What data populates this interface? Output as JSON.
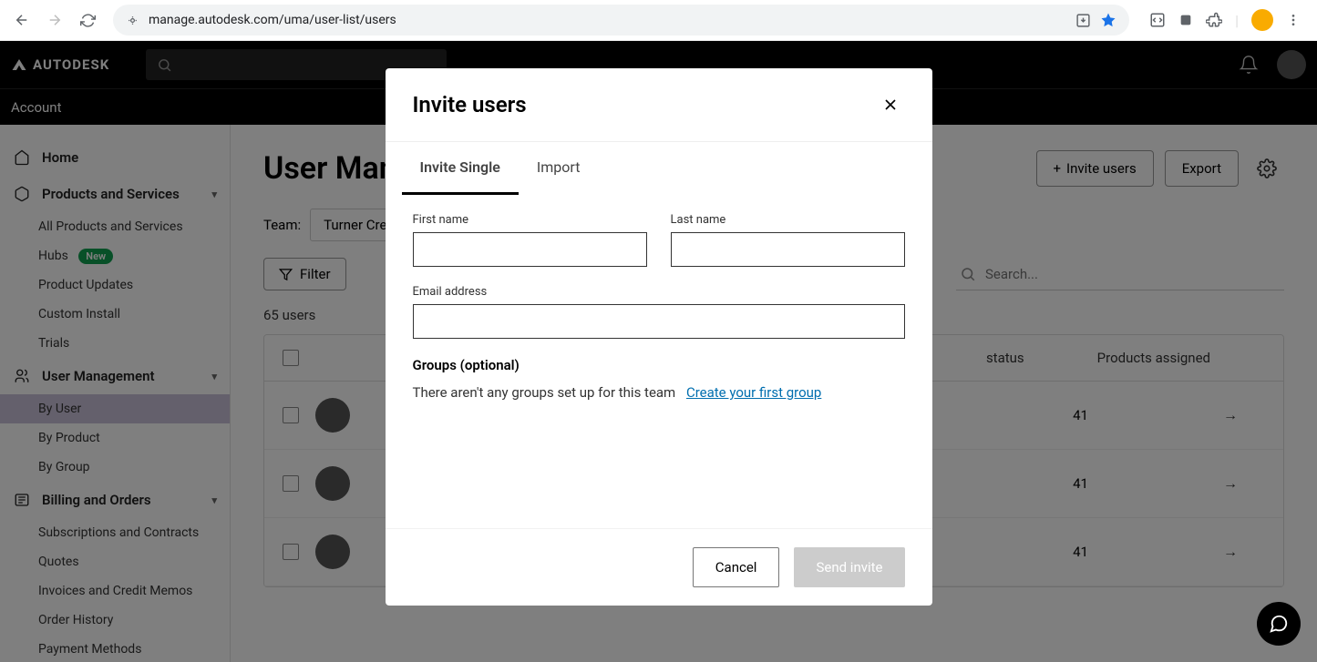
{
  "browser": {
    "url": "manage.autodesk.com/uma/user-list/users"
  },
  "app": {
    "brand": "AUTODESK",
    "subnav": "Account"
  },
  "sidebar": {
    "home": "Home",
    "products_section": "Products and Services",
    "products": {
      "all": "All Products and Services",
      "hubs": "Hubs",
      "hubs_badge": "New",
      "updates": "Product Updates",
      "custom_install": "Custom Install",
      "trials": "Trials"
    },
    "user_section": "User Management",
    "users": {
      "by_user": "By User",
      "by_product": "By Product",
      "by_group": "By Group"
    },
    "billing_section": "Billing and Orders",
    "billing": {
      "subs": "Subscriptions and Contracts",
      "quotes": "Quotes",
      "invoices": "Invoices and Credit Memos",
      "history": "Order History",
      "payment": "Payment Methods"
    }
  },
  "page": {
    "title": "User Management",
    "invite_btn": "Invite users",
    "export_btn": "Export",
    "team_label": "Team:",
    "team_value": "Turner Cre",
    "filter_btn": "Filter",
    "search_placeholder": "Search...",
    "count": "65 users",
    "columns": {
      "status": "status",
      "products": "Products assigned"
    },
    "rows": [
      {
        "products": "41"
      },
      {
        "products": "41"
      },
      {
        "products": "41"
      }
    ]
  },
  "modal": {
    "title": "Invite users",
    "tab_single": "Invite Single",
    "tab_import": "Import",
    "first_name": "First name",
    "last_name": "Last name",
    "email": "Email address",
    "groups_title": "Groups (optional)",
    "groups_text": "There aren't any groups set up for this team",
    "groups_link": "Create your first group",
    "cancel": "Cancel",
    "send": "Send invite"
  }
}
